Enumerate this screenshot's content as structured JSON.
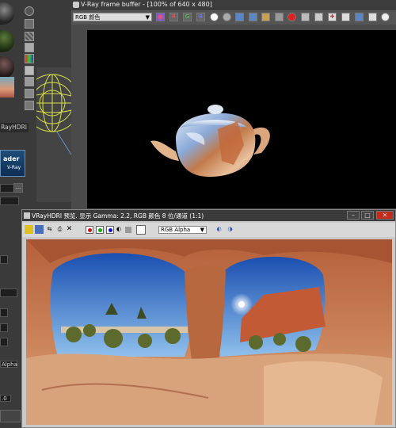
{
  "vfb": {
    "title": "V-Ray frame buffer - [100% of 640 x 480]",
    "channel": "RGB 颜色",
    "buttons": {
      "r": "R",
      "g": "G",
      "b": "B"
    }
  },
  "left": {
    "tab_label": "RayHDRI",
    "loader_line1": "ader",
    "loader_line2": "V-Ray",
    "alpha_label": "Alpha",
    "ellipsis": "...",
    "value": ".0"
  },
  "hdri": {
    "title": "VRayHDRI 预览. 显示 Gamma: 2.2, RGB 颜色 8 位/通道 (1:1)",
    "channel": "RGB Alpha"
  },
  "colors": {
    "vfb_bg": "#4a4a4a",
    "hdri_bg": "#c9c9c9",
    "close": "#c42b1c"
  }
}
